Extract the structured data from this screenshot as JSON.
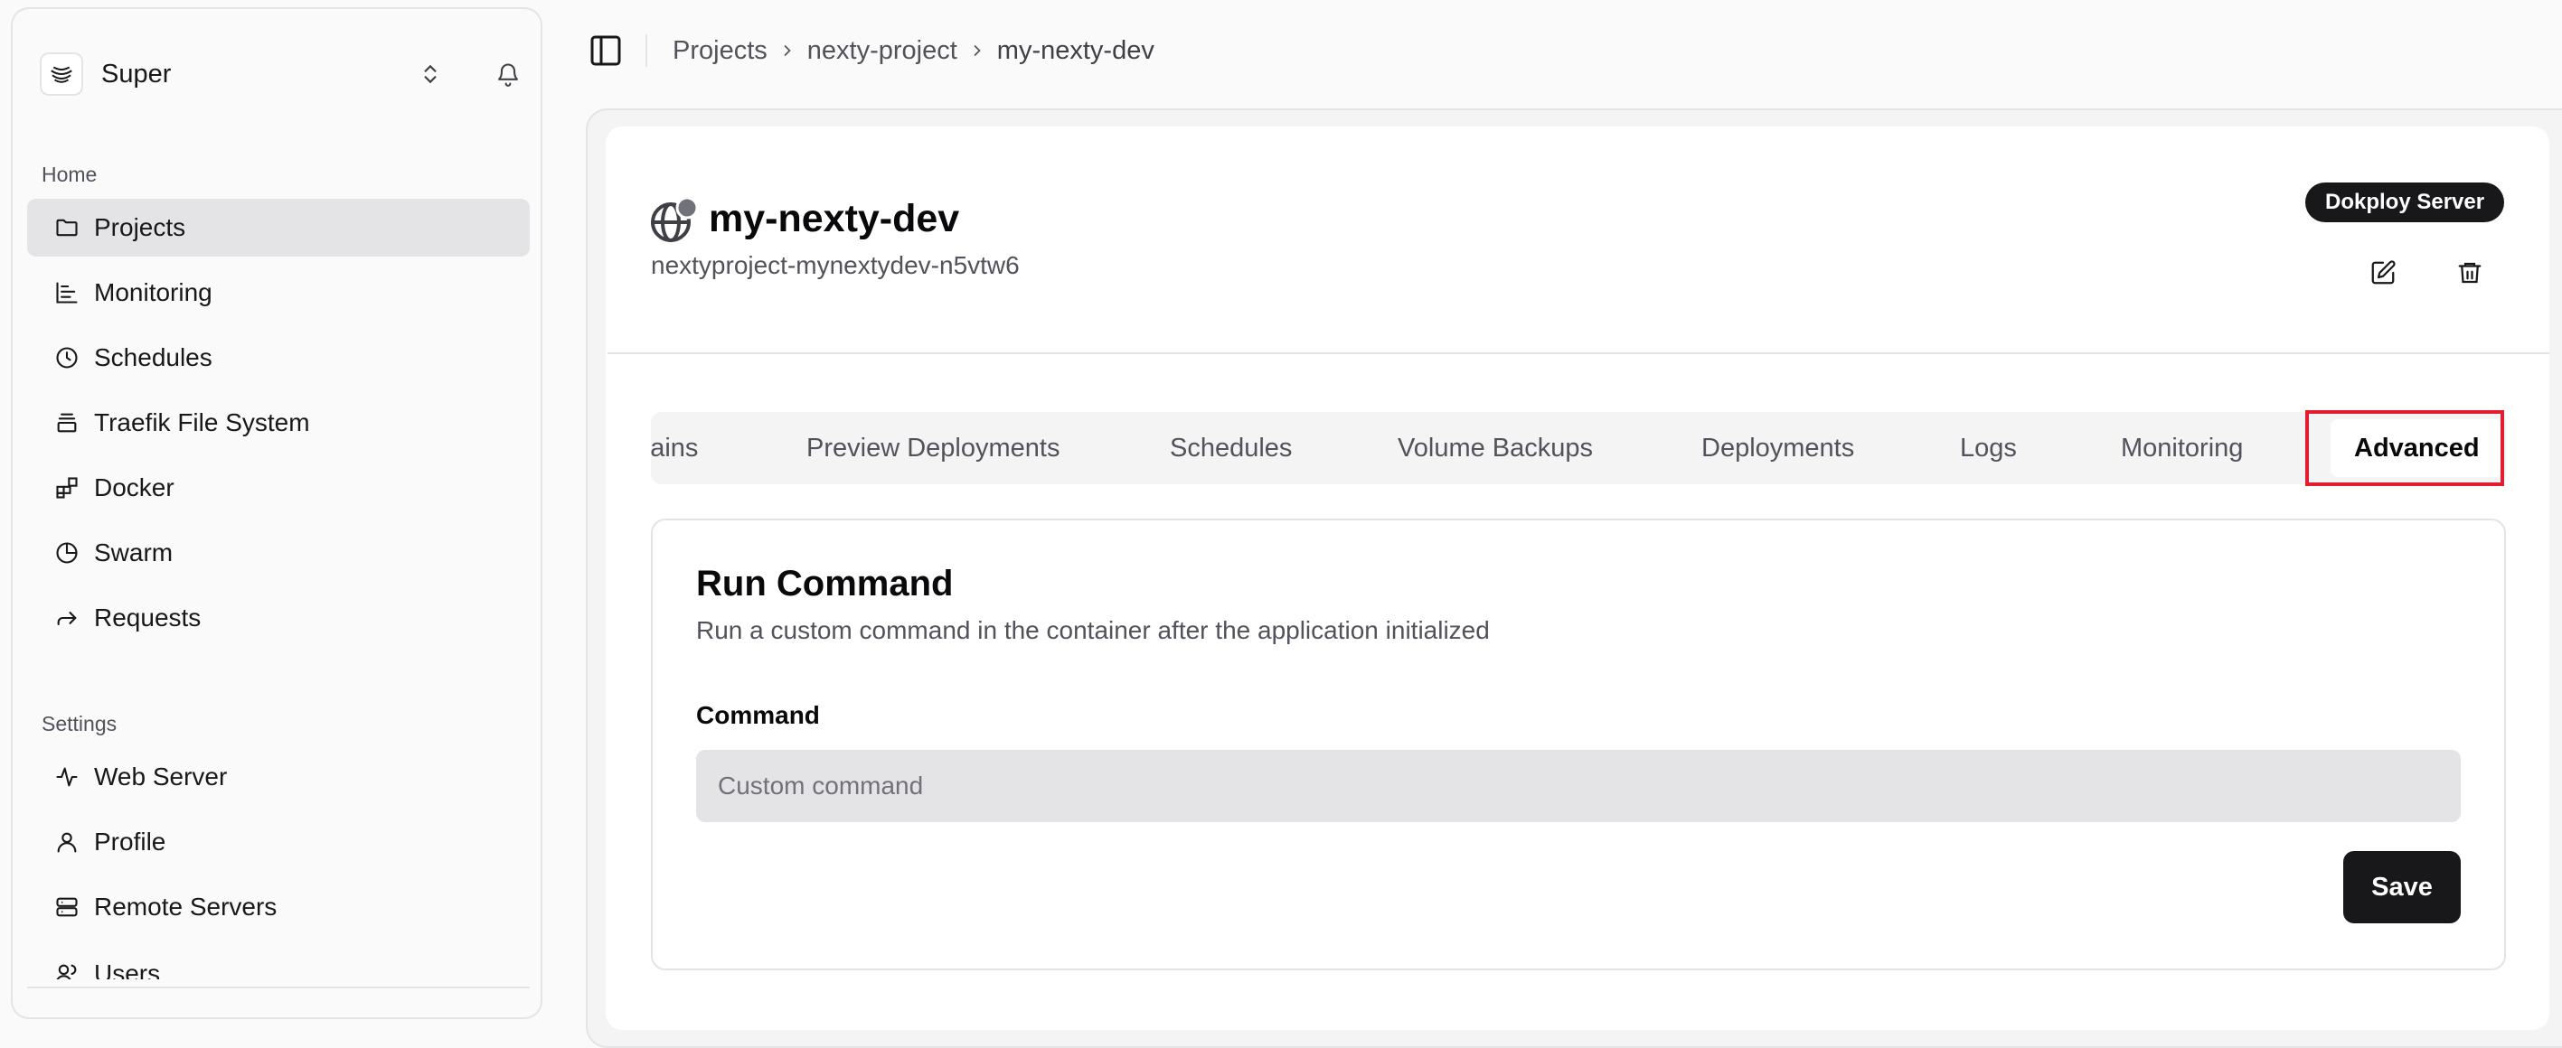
{
  "sidebar": {
    "workspace": {
      "name": "Super"
    },
    "groups": [
      {
        "label": "Home"
      },
      {
        "label": "Settings"
      }
    ],
    "items": [
      {
        "label": "Projects",
        "icon": "folder-icon"
      },
      {
        "label": "Monitoring",
        "icon": "chart-icon"
      },
      {
        "label": "Schedules",
        "icon": "clock-icon"
      },
      {
        "label": "Traefik File System",
        "icon": "layers-icon"
      },
      {
        "label": "Docker",
        "icon": "blocks-icon"
      },
      {
        "label": "Swarm",
        "icon": "pie-icon"
      },
      {
        "label": "Requests",
        "icon": "forward-arrow-icon"
      },
      {
        "label": "Web Server",
        "icon": "activity-icon"
      },
      {
        "label": "Profile",
        "icon": "user-icon"
      },
      {
        "label": "Remote Servers",
        "icon": "server-icon"
      },
      {
        "label": "Users",
        "icon": "users-icon"
      }
    ]
  },
  "breadcrumb": [
    "Projects",
    "nexty-project",
    "my-nexty-dev"
  ],
  "app": {
    "title": "my-nexty-dev",
    "subtitle": "nextyproject-mynextydev-n5vtw6",
    "server_badge": "Dokploy Server"
  },
  "tabs": [
    {
      "label": "Domains"
    },
    {
      "label": "Preview Deployments"
    },
    {
      "label": "Schedules"
    },
    {
      "label": "Volume Backups"
    },
    {
      "label": "Deployments"
    },
    {
      "label": "Logs"
    },
    {
      "label": "Monitoring"
    },
    {
      "label": "Advanced",
      "active": true
    }
  ],
  "run_command": {
    "title": "Run Command",
    "description": "Run a custom command in the container after the application initialized",
    "field_label": "Command",
    "placeholder": "Custom command",
    "value": "",
    "save_label": "Save"
  },
  "colors": {
    "active_bg": "#e4e4e7",
    "primary": "#18181b",
    "highlight": "#e11d2e"
  }
}
